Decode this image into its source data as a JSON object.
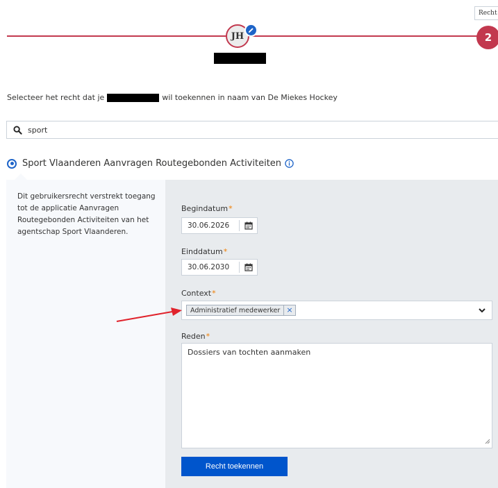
{
  "stepper": {
    "avatar_initials": "JH",
    "step_number": "2",
    "tooltip": "Recht",
    "line_color": "#c2384e"
  },
  "instruction": {
    "prefix": "Selecteer het recht dat je",
    "suffix": "wil toekennen in naam van De Miekes Hockey"
  },
  "search": {
    "value": "sport",
    "icon": "search-icon"
  },
  "right": {
    "title": "Sport Vlaanderen Aanvragen Routegebonden Activiteiten",
    "description": "Dit gebruikersrecht verstrekt toegang tot de applicatie Aanvragen Routegebonden Activiteiten van het agentschap Sport Vlaanderen."
  },
  "form": {
    "begindatum_label": "Begindatum",
    "begindatum_value": "30.06.2026",
    "einddatum_label": "Einddatum",
    "einddatum_value": "30.06.2030",
    "context_label": "Context",
    "context_selected": "Administratief medewerker",
    "reden_label": "Reden",
    "reden_value": "Dossiers van tochten aanmaken",
    "required_mark": "*",
    "submit_label": "Recht toekennen"
  },
  "colors": {
    "primary": "#0055cc",
    "accent": "#c2384e",
    "required": "#f07d00"
  }
}
